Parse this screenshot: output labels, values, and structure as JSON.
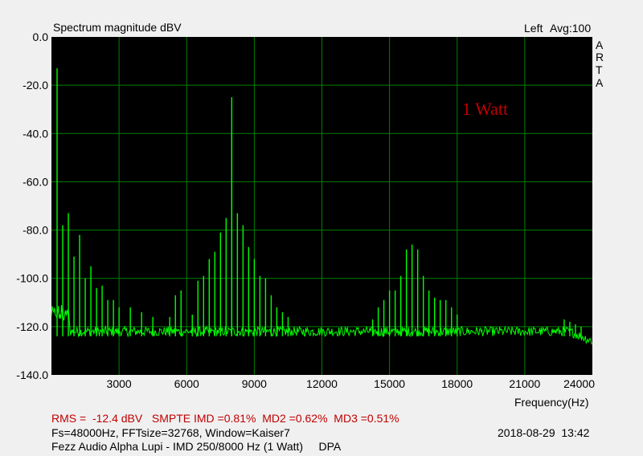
{
  "header": {
    "title": "Spectrum magnitude dBV",
    "channel": "Left",
    "average": "Avg:100",
    "brand_letters": [
      "A",
      "R",
      "T",
      "A"
    ]
  },
  "annotation": {
    "text": "1 Watt",
    "color": "#c00000"
  },
  "footer": {
    "stats_line": "RMS =  -12.4 dBV   SMPTE IMD =0.81%  MD2 =0.62%  MD3 =0.51%",
    "params_line": "Fs=48000Hz, FFTsize=32768, Window=Kaiser7",
    "timestamp": "2018-08-29  13:42",
    "description": "Fezz Audio Alpha Lupi - IMD 250/8000 Hz (1 Watt)     DPA"
  },
  "colors": {
    "plot_bg": "#000000",
    "grid": "#008000",
    "trace": "#00ff00",
    "stats_text": "#c00000"
  },
  "chart_data": {
    "type": "line",
    "title": "Spectrum magnitude dBV",
    "xlabel": "Frequency(Hz)",
    "ylabel": "",
    "xlim": [
      0,
      24000
    ],
    "ylim": [
      -140,
      0
    ],
    "x_ticks": [
      "3000",
      "6000",
      "9000",
      "12000",
      "15000",
      "18000",
      "21000",
      "24000"
    ],
    "y_ticks": [
      "0.0",
      "-20.0",
      "-40.0",
      "-60.0",
      "-80.0",
      "-100.0",
      "-120.0",
      "-140.0"
    ],
    "grid": true,
    "noise_floor_db": -122,
    "series": [
      {
        "color": "#00ff00",
        "peaks": [
          [
            250,
            -13
          ],
          [
            500,
            -78
          ],
          [
            750,
            -73
          ],
          [
            1000,
            -91
          ],
          [
            1250,
            -82
          ],
          [
            1500,
            -100
          ],
          [
            1750,
            -95
          ],
          [
            2000,
            -104
          ],
          [
            2250,
            -103
          ],
          [
            2500,
            -109
          ],
          [
            2750,
            -109
          ],
          [
            3000,
            -112
          ],
          [
            3500,
            -112
          ],
          [
            4000,
            -114
          ],
          [
            4500,
            -116
          ],
          [
            5250,
            -116
          ],
          [
            5500,
            -107
          ],
          [
            5750,
            -105
          ],
          [
            6250,
            -115
          ],
          [
            6500,
            -101
          ],
          [
            6750,
            -99
          ],
          [
            7000,
            -92
          ],
          [
            7250,
            -89
          ],
          [
            7500,
            -81
          ],
          [
            7750,
            -75
          ],
          [
            8000,
            -25
          ],
          [
            8000,
            -40
          ],
          [
            8250,
            -73
          ],
          [
            8500,
            -78
          ],
          [
            8750,
            -87
          ],
          [
            9000,
            -92
          ],
          [
            9250,
            -99
          ],
          [
            9500,
            -100
          ],
          [
            9750,
            -107
          ],
          [
            10000,
            -112
          ],
          [
            10250,
            -114
          ],
          [
            10500,
            -116
          ],
          [
            14250,
            -117
          ],
          [
            14500,
            -112
          ],
          [
            14750,
            -109
          ],
          [
            15000,
            -105
          ],
          [
            15250,
            -105
          ],
          [
            15500,
            -99
          ],
          [
            15750,
            -88
          ],
          [
            16000,
            -86
          ],
          [
            16250,
            -88
          ],
          [
            16500,
            -99
          ],
          [
            16750,
            -105
          ],
          [
            17000,
            -108
          ],
          [
            17250,
            -109
          ],
          [
            17500,
            -109
          ],
          [
            17750,
            -112
          ],
          [
            18000,
            -115
          ],
          [
            22750,
            -117
          ],
          [
            23000,
            -118
          ],
          [
            23250,
            -119
          ],
          [
            23500,
            -120
          ]
        ]
      }
    ]
  }
}
